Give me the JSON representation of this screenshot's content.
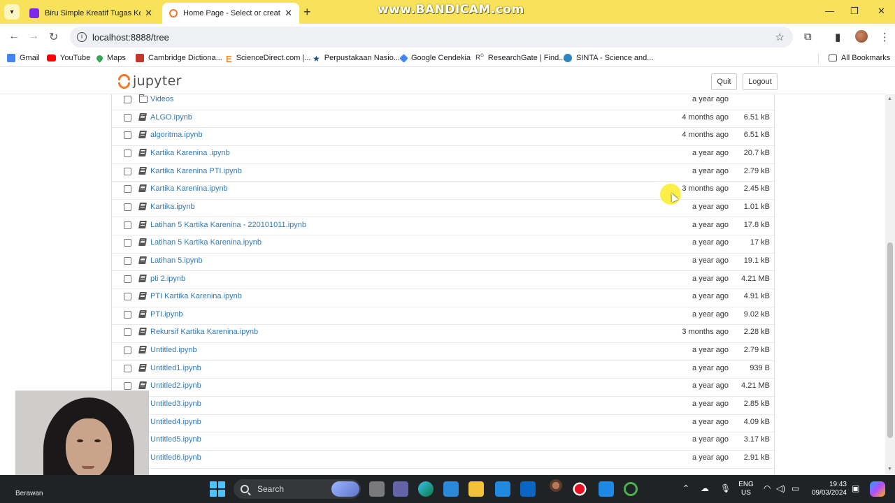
{
  "browser": {
    "tabs": [
      {
        "title": "Biru Simple Kreatif Tugas Kelom",
        "active": false
      },
      {
        "title": "Home Page - Select or create a",
        "active": true
      }
    ],
    "watermark": "www.BANDICAM.com",
    "url": "localhost:8888/tree",
    "bookmarks": [
      {
        "label": "Gmail",
        "color": "#4285f4"
      },
      {
        "label": "YouTube",
        "color": "#ff0000"
      },
      {
        "label": "Maps",
        "color": "#34a853"
      },
      {
        "label": "Cambridge Dictiona...",
        "color": "#c0392b"
      },
      {
        "label": "ScienceDirect.com |...",
        "color": "#f28c28"
      },
      {
        "label": "Perpustakaan Nasio...",
        "color": "#1a5276"
      },
      {
        "label": "Google Cendekia",
        "color": "#4285f4"
      },
      {
        "label": "ResearchGate | Find...",
        "color": "#ffffff"
      },
      {
        "label": "SINTA - Science and...",
        "color": "#2e86c1"
      }
    ],
    "all_bookmarks": "All Bookmarks"
  },
  "jupyter": {
    "logo_text": "jupyter",
    "quit_label": "Quit",
    "logout_label": "Logout",
    "accent": "#f37726",
    "files": [
      {
        "name": "Videos",
        "type": "folder",
        "modified": "a year ago",
        "size": ""
      },
      {
        "name": "ALGO.ipynb",
        "type": "notebook",
        "modified": "4 months ago",
        "size": "6.51 kB"
      },
      {
        "name": "algoritma.ipynb",
        "type": "notebook",
        "modified": "4 months ago",
        "size": "6.51 kB"
      },
      {
        "name": "Kartika Karenina .ipynb",
        "type": "notebook",
        "modified": "a year ago",
        "size": "20.7 kB"
      },
      {
        "name": "Kartika Karenina PTI.ipynb",
        "type": "notebook",
        "modified": "a year ago",
        "size": "2.79 kB"
      },
      {
        "name": "Kartika Karenina.ipynb",
        "type": "notebook",
        "modified": "3 months ago",
        "size": "2.45 kB"
      },
      {
        "name": "Kartika.ipynb",
        "type": "notebook",
        "modified": "a year ago",
        "size": "1.01 kB"
      },
      {
        "name": "Latihan 5 Kartika Karenina - 220101011.ipynb",
        "type": "notebook",
        "modified": "a year ago",
        "size": "17.8 kB"
      },
      {
        "name": "Latihan 5 Kartika Karenina.ipynb",
        "type": "notebook",
        "modified": "a year ago",
        "size": "17 kB"
      },
      {
        "name": "Latihan 5.ipynb",
        "type": "notebook",
        "modified": "a year ago",
        "size": "19.1 kB"
      },
      {
        "name": "pti 2.ipynb",
        "type": "notebook",
        "modified": "a year ago",
        "size": "4.21 MB"
      },
      {
        "name": "PTI Kartika Karenina.ipynb",
        "type": "notebook",
        "modified": "a year ago",
        "size": "4.91 kB"
      },
      {
        "name": "PTI.ipynb",
        "type": "notebook",
        "modified": "a year ago",
        "size": "9.02 kB"
      },
      {
        "name": "Rekursif Kartika Karenina.ipynb",
        "type": "notebook",
        "modified": "3 months ago",
        "size": "2.28 kB"
      },
      {
        "name": "Untitled.ipynb",
        "type": "notebook",
        "modified": "a year ago",
        "size": "2.79 kB"
      },
      {
        "name": "Untitled1.ipynb",
        "type": "notebook",
        "modified": "a year ago",
        "size": "939 B"
      },
      {
        "name": "Untitled2.ipynb",
        "type": "notebook",
        "modified": "a year ago",
        "size": "4.21 MB"
      },
      {
        "name": "Untitled3.ipynb",
        "type": "notebook",
        "modified": "a year ago",
        "size": "2.85 kB"
      },
      {
        "name": "Untitled4.ipynb",
        "type": "notebook",
        "modified": "a year ago",
        "size": "4.09 kB"
      },
      {
        "name": "Untitled5.ipynb",
        "type": "notebook",
        "modified": "a year ago",
        "size": "3.17 kB"
      },
      {
        "name": "Untitled6.ipynb",
        "type": "notebook",
        "modified": "a year ago",
        "size": "2.91 kB"
      }
    ]
  },
  "webcam": {
    "caption": "Berawan"
  },
  "taskbar": {
    "search_placeholder": "Search",
    "lang_line1": "ENG",
    "lang_line2": "US",
    "time": "19:43",
    "date": "09/03/2024"
  }
}
